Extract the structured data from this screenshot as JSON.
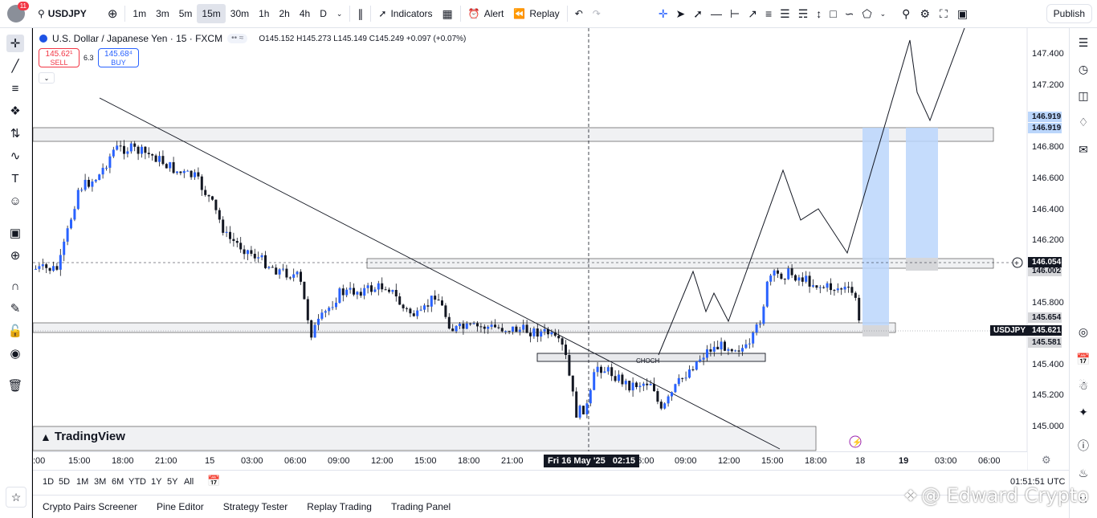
{
  "topbar": {
    "avatar_badge": "11",
    "symbol": "USDJPY",
    "timeframes": [
      "1m",
      "3m",
      "5m",
      "15m",
      "30m",
      "1h",
      "2h",
      "4h",
      "D"
    ],
    "active_timeframe": "15m",
    "indicators_label": "Indicators",
    "alert_label": "Alert",
    "replay_label": "Replay",
    "publish_label": "Publish"
  },
  "legend": {
    "title": "U.S. Dollar / Japanese Yen · 15 · FXCM",
    "ohlc": "O145.152 H145.273 L145.149 C145.249 +0.097 (+0.07%)",
    "sell_price": "145.62¹",
    "sell_label": "SELL",
    "spread": "6.3",
    "buy_price": "145.68⁴",
    "buy_label": "BUY"
  },
  "chart": {
    "watermark": "TradingView",
    "choch_label": "CHOCH",
    "price_axis": [
      "147.400",
      "147.200",
      "146.800",
      "146.600",
      "146.400",
      "146.200",
      "145.800",
      "145.400",
      "145.200",
      "145.000"
    ],
    "time_axis": [
      ":00",
      "15:00",
      "18:00",
      "21:00",
      "15",
      "03:00",
      "06:00",
      "09:00",
      "12:00",
      "15:00",
      "18:00",
      "21:00",
      "06:00",
      "09:00",
      "12:00",
      "15:00",
      "18:00",
      "18",
      "19",
      "03:00",
      "06:00"
    ],
    "crosshair_time": "Fri 16 May '25",
    "crosshair_time2": "02:15",
    "tags": {
      "zone_top_1": "146.919",
      "zone_top_2": "146.919",
      "crosshair_price": "146.054",
      "upper_zone_low": "146.002",
      "lower_zone_high": "145.654",
      "current_symbol": "USDJPY",
      "current_price": "145.621",
      "lower_zone_low": "145.581"
    },
    "colors": {
      "up": "#2962ff",
      "down": "#131722",
      "zone_blue": "#bbd6fb",
      "sell_red": "#f23645"
    }
  },
  "bottombar": {
    "ranges": [
      "1D",
      "5D",
      "1M",
      "3M",
      "6M",
      "YTD",
      "1Y",
      "5Y",
      "All"
    ],
    "clock": "01:51:51 UTC",
    "tabs": [
      "Crypto Pairs Screener",
      "Pine Editor",
      "Strategy Tester",
      "Replay Trading",
      "Trading Panel"
    ]
  },
  "brand": "@ Edward Crypto"
}
